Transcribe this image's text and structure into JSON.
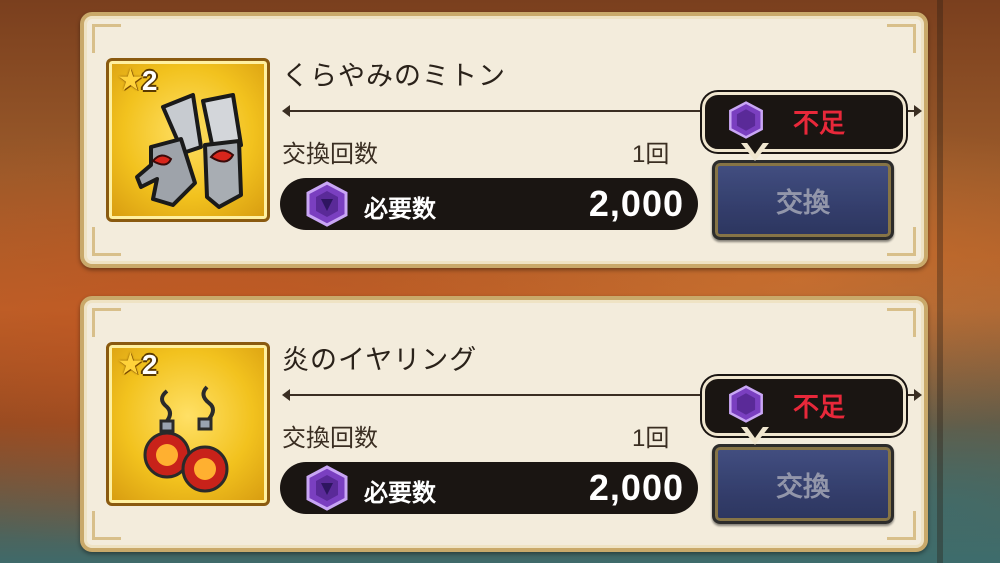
{
  "items": [
    {
      "name": "くらやみのミトン",
      "rarity": "2",
      "count_label": "交換回数",
      "count_value": "1回",
      "cost_label": "必要数",
      "cost_value": "2,000",
      "button_label": "交換",
      "shortage_label": "不足",
      "icon": "gauntlets-icon"
    },
    {
      "name": "炎のイヤリング",
      "rarity": "2",
      "count_label": "交換回数",
      "count_value": "1回",
      "cost_label": "必要数",
      "cost_value": "2,000",
      "button_label": "交換",
      "shortage_label": "不足",
      "icon": "earrings-icon"
    }
  ],
  "colors": {
    "card_bg": "#f3ecdc",
    "item_frame": "#f2c21e",
    "button_bg": "#243063",
    "shortage_text": "#e8283a",
    "gem": "#7a3fc0"
  }
}
